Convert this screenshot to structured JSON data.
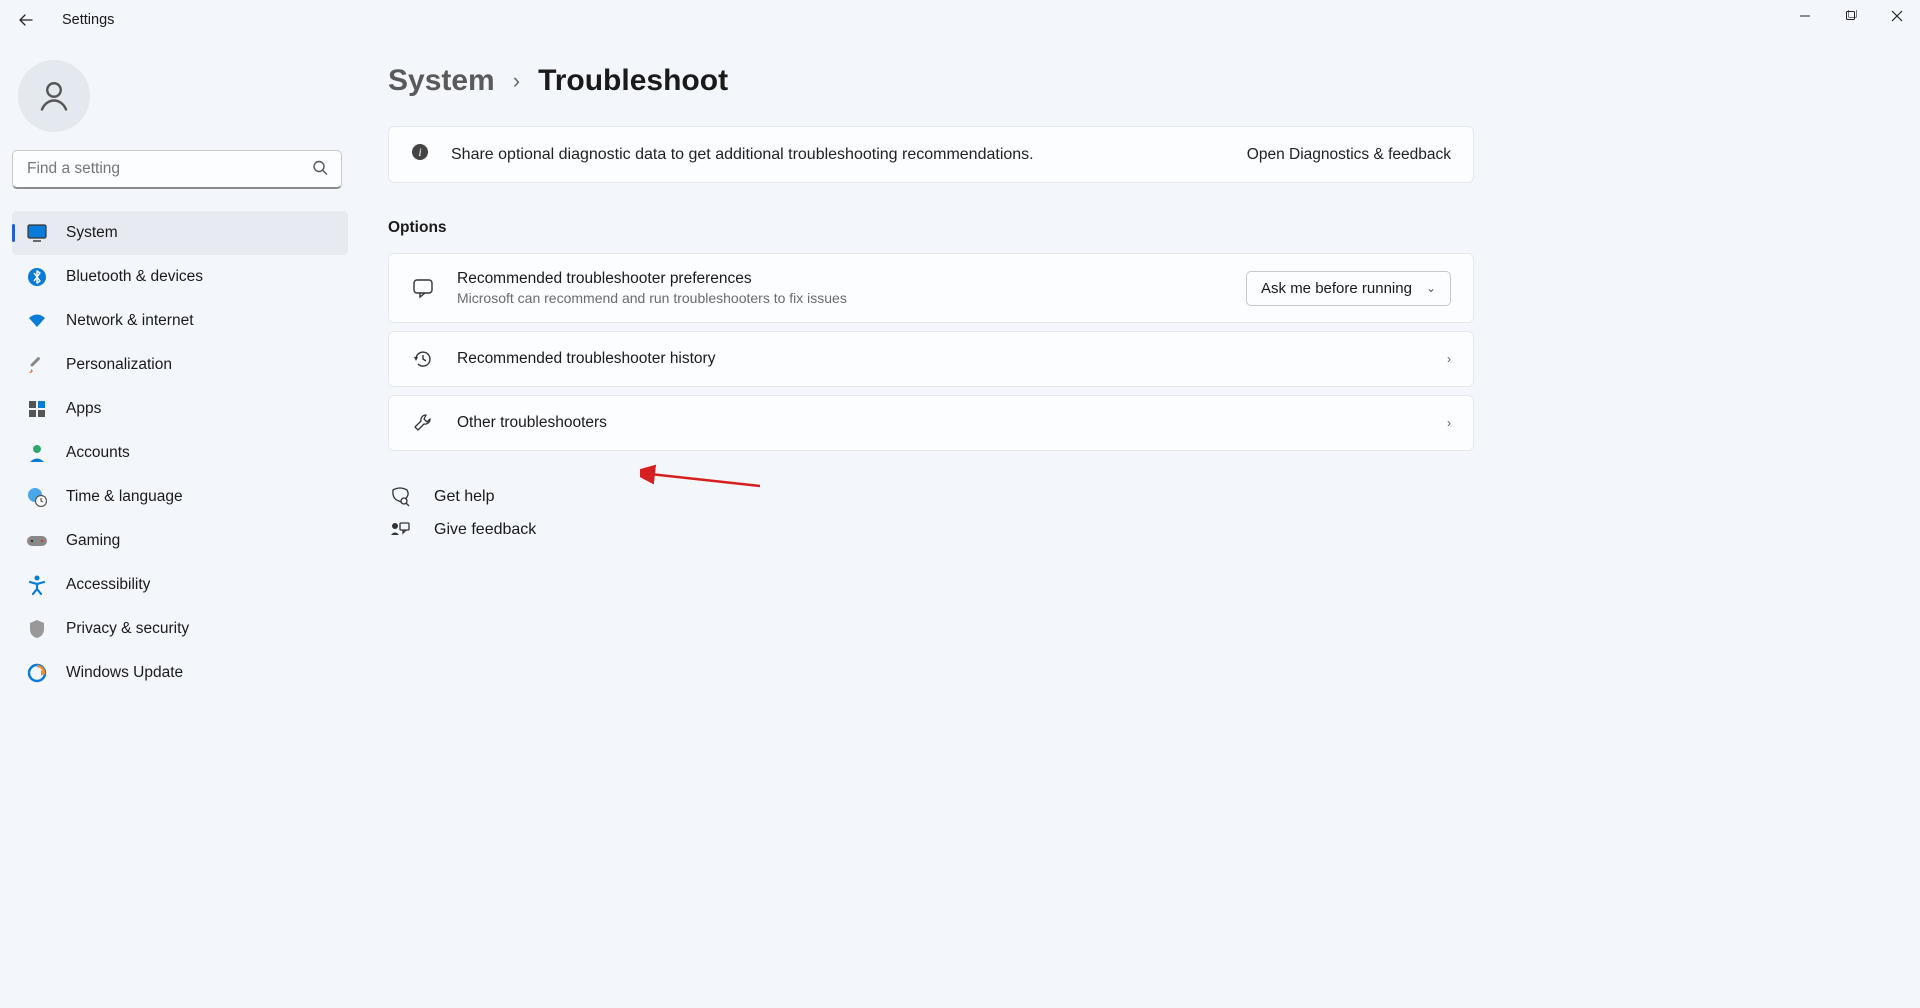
{
  "app_title": "Settings",
  "search": {
    "placeholder": "Find a setting"
  },
  "sidebar": {
    "items": [
      {
        "label": "System"
      },
      {
        "label": "Bluetooth & devices"
      },
      {
        "label": "Network & internet"
      },
      {
        "label": "Personalization"
      },
      {
        "label": "Apps"
      },
      {
        "label": "Accounts"
      },
      {
        "label": "Time & language"
      },
      {
        "label": "Gaming"
      },
      {
        "label": "Accessibility"
      },
      {
        "label": "Privacy & security"
      },
      {
        "label": "Windows Update"
      }
    ]
  },
  "breadcrumb": {
    "parent": "System",
    "current": "Troubleshoot"
  },
  "banner": {
    "message": "Share optional diagnostic data to get additional troubleshooting recommendations.",
    "action": "Open Diagnostics & feedback"
  },
  "options_label": "Options",
  "cards": {
    "pref": {
      "title": "Recommended troubleshooter preferences",
      "subtitle": "Microsoft can recommend and run troubleshooters to fix issues",
      "dropdown_value": "Ask me before running"
    },
    "history": {
      "title": "Recommended troubleshooter history"
    },
    "other": {
      "title": "Other troubleshooters"
    }
  },
  "footer": {
    "help": "Get help",
    "feedback": "Give feedback"
  }
}
